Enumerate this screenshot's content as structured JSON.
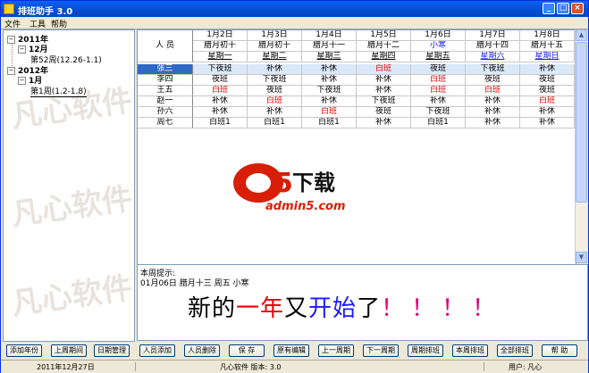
{
  "window": {
    "title": "排班助手 3.0"
  },
  "titlebar_buttons": {
    "min": "_",
    "max": "□",
    "close": "×"
  },
  "menu": [
    "文件",
    "工具",
    "帮助"
  ],
  "tree": {
    "year1": "2011年",
    "month1": "12月",
    "week1": "第52周(12.26-1.1)",
    "year2": "2012年",
    "month2": "1月",
    "week2": "第1周(1.2-1.8)"
  },
  "grid": {
    "corner": "人 员",
    "dates": [
      "1月2日",
      "1月3日",
      "1月4日",
      "1月5日",
      "1月6日",
      "1月7日",
      "1月8日"
    ],
    "lunar": [
      "腊月初十",
      "腊月初十",
      "腊月十一",
      "腊月十二",
      "小寒",
      "腊月十四",
      "腊月十五"
    ],
    "weekdays": [
      "星期一",
      "星期二",
      "星期三",
      "星期四",
      "星期五",
      "星期六",
      "星期日"
    ],
    "rows": [
      {
        "name": "张三",
        "cells": [
          "下夜班",
          "补休",
          "补休",
          "白班",
          "夜班",
          "下夜班",
          "补休"
        ]
      },
      {
        "name": "李四",
        "cells": [
          "夜班",
          "下夜班",
          "补休",
          "补休",
          "白班",
          "夜班",
          "夜班"
        ]
      },
      {
        "name": "王五",
        "cells": [
          "白班",
          "夜班",
          "下夜班",
          "补休",
          "白班",
          "白班",
          "夜班"
        ]
      },
      {
        "name": "赵一",
        "cells": [
          "补休",
          "白班",
          "补休",
          "下夜班",
          "补休",
          "补休",
          "白班"
        ]
      },
      {
        "name": "孙六",
        "cells": [
          "补休",
          "补休",
          "白班",
          "夜班",
          "下夜班",
          "补休",
          "补休"
        ]
      },
      {
        "name": "周七",
        "cells": [
          "白班1",
          "白班1",
          "白班1",
          "补休",
          "白班1",
          "补休",
          "补休"
        ]
      }
    ]
  },
  "colors": {
    "red_shift": "#e00000",
    "selected_row": "#dbe8f8",
    "blue_text": "#1a1aff"
  },
  "logo": {
    "text": "a5下载",
    "domain": "admin5.com"
  },
  "notes": {
    "label": "本周提示:",
    "line": "01月06日   腊月十三  周五  小寒",
    "big_parts": [
      "新的",
      "一年",
      "又",
      "开始",
      "了",
      "！！！！"
    ]
  },
  "left_buttons": [
    "添加年份",
    "上周期间",
    "日期管理"
  ],
  "right_buttons": [
    "人员添加",
    "人员删除",
    "保  存",
    "原有编辑",
    "上一周期",
    "下一周期",
    "周期排班",
    "本周排班",
    "全部排班",
    "帮  助"
  ],
  "status": {
    "date": "2011年12月27日",
    "company": "凡心软件  版本: 3.0",
    "user": "用户: 凡心"
  }
}
